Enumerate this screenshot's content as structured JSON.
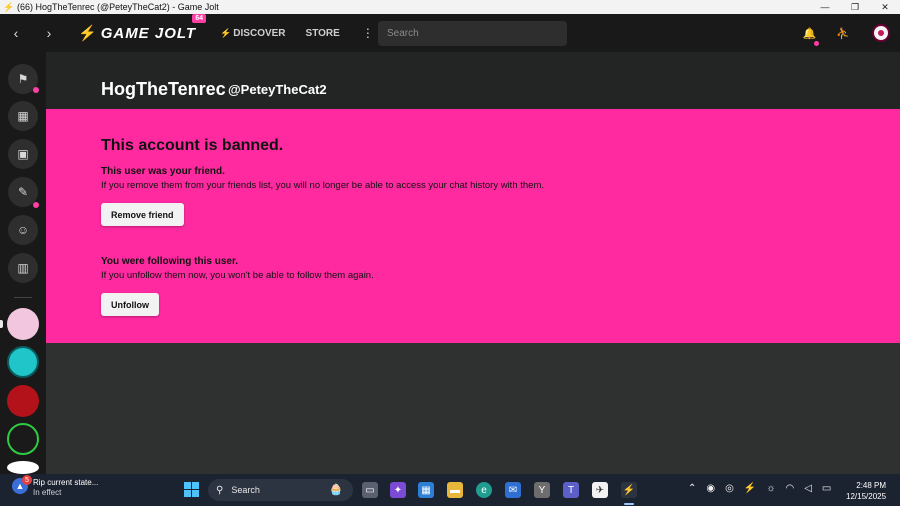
{
  "window": {
    "title": "(66) HogTheTenrec (@PeteyTheCat2) - Game Jolt",
    "minimize": "—",
    "restore": "❐",
    "close": "✕"
  },
  "nav": {
    "back": "‹",
    "forward": "›",
    "logo": "GAME JOLT",
    "logo_badge": "64",
    "discover": "DISCOVER",
    "store": "STORE",
    "more": "⋮",
    "search_placeholder": "Search"
  },
  "sidebar": {
    "items": [
      {
        "name": "activity",
        "icon": "activity-icon"
      },
      {
        "name": "store",
        "icon": "store-icon"
      },
      {
        "name": "backpack",
        "icon": "backpack-icon"
      },
      {
        "name": "quests",
        "icon": "quests-icon"
      },
      {
        "name": "chat",
        "icon": "chat-icon"
      },
      {
        "name": "library",
        "icon": "library-icon"
      }
    ],
    "communities": [
      {
        "name": "community-1",
        "color": "#f3c6df"
      },
      {
        "name": "community-2",
        "color": "#1fc5c9"
      },
      {
        "name": "community-3",
        "color": "#b3121b"
      },
      {
        "name": "community-4",
        "color": "#1a1a1a"
      },
      {
        "name": "community-5",
        "color": "#ffffff"
      }
    ]
  },
  "profile": {
    "display_name": "HogTheTenrec",
    "username": "@PeteyTheCat2"
  },
  "banned": {
    "heading": "This account is banned.",
    "friend_title": "This user was your friend.",
    "friend_text": "If you remove them from your friends list, you will no longer be able to access your chat history with them.",
    "remove_friend": "Remove friend",
    "follow_title": "You were following this user.",
    "follow_text": "If you unfollow them now, you won't be able to follow them again.",
    "unfollow": "Unfollow"
  },
  "taskbar": {
    "weather_badge": "5",
    "weather_title": "Rip current state...",
    "weather_sub": "In effect",
    "search": "Search",
    "time": "2:48 PM",
    "date": "12/15/2025"
  },
  "colors": {
    "accent": "#ff2aa0",
    "nav_bg": "#191919",
    "content_bg": "#2f3131"
  }
}
